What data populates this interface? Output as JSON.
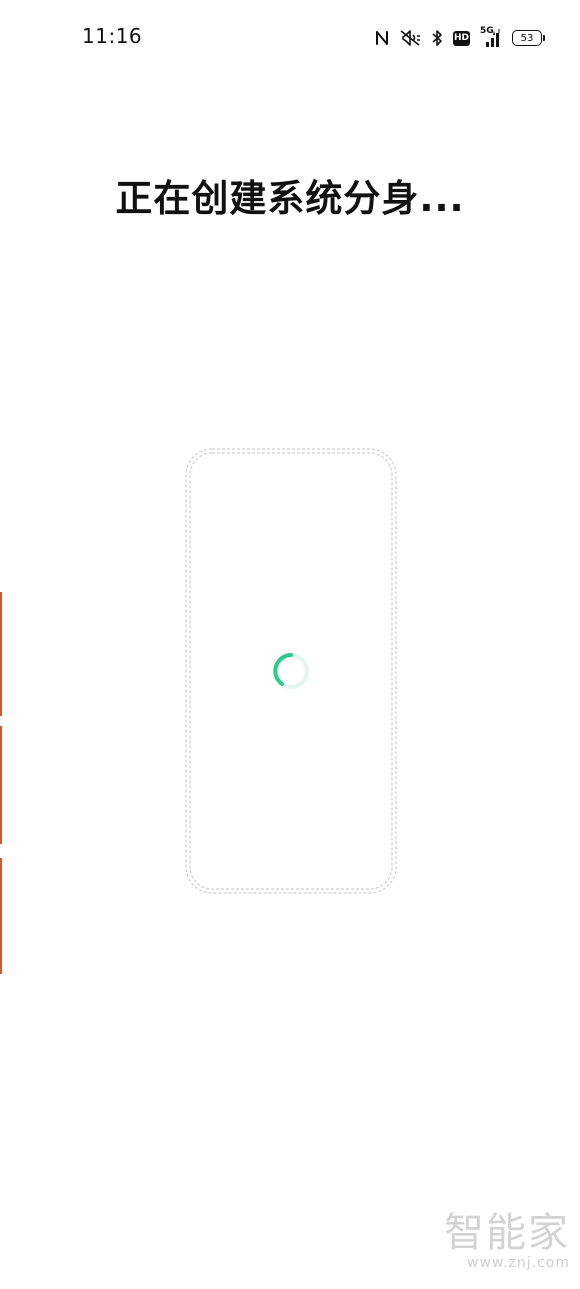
{
  "status_bar": {
    "time": "11:16",
    "network": "5G",
    "hd_label": "HD",
    "battery_level": "53",
    "icons": [
      "nfc-icon",
      "mute-icon",
      "bluetooth-icon",
      "hd-icon",
      "signal-icon",
      "battery-icon"
    ]
  },
  "main": {
    "title": "正在创建系统分身..."
  },
  "loading": {
    "accent_color": "#2ecc8a"
  },
  "watermark": {
    "text": "智能家",
    "url": "www.znj.com"
  }
}
